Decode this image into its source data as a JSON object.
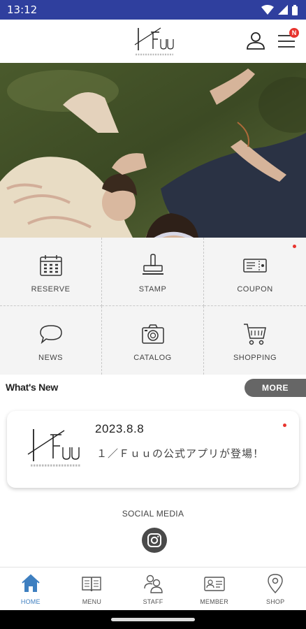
{
  "status_bar": {
    "time": "13:12"
  },
  "header": {
    "notification_count": "N"
  },
  "grid": {
    "items": [
      {
        "label": "RESERVE",
        "icon": "calendar-icon"
      },
      {
        "label": "STAMP",
        "icon": "stamp-icon"
      },
      {
        "label": "COUPON",
        "icon": "coupon-icon",
        "has_dot": true
      },
      {
        "label": "NEWS",
        "icon": "speech-bubble-icon"
      },
      {
        "label": "CATALOG",
        "icon": "camera-icon"
      },
      {
        "label": "SHOPPING",
        "icon": "cart-icon"
      }
    ]
  },
  "whats_new": {
    "title": "What's New",
    "more_label": "MORE"
  },
  "news": [
    {
      "date": "2023.8.8",
      "text": "１／Ｆｕｕの公式アプリが登場！",
      "unread": true
    }
  ],
  "social": {
    "label": "SOCIAL MEDIA",
    "icon": "instagram-icon"
  },
  "tabbar": {
    "items": [
      {
        "label": "HOME",
        "icon": "home-icon",
        "active": true
      },
      {
        "label": "MENU",
        "icon": "book-icon",
        "active": false
      },
      {
        "label": "STAFF",
        "icon": "staff-icon",
        "active": false
      },
      {
        "label": "MEMBER",
        "icon": "member-card-icon",
        "active": false
      },
      {
        "label": "SHOP",
        "icon": "location-pin-icon",
        "active": false
      }
    ]
  },
  "colors": {
    "status_bar": "#2f3f9e",
    "accent_blue": "#3e7fc0",
    "badge_red": "#e8342e",
    "more_button": "#666666"
  }
}
